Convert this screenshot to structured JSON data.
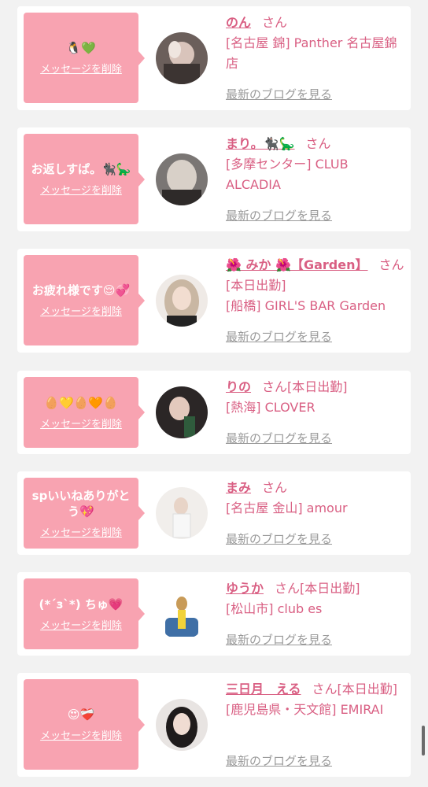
{
  "delete_label": "メッセージを削除",
  "blog_label": "最新のブログを見る",
  "san_label": "さん",
  "colors": {
    "accent": "#d95f83",
    "bubble": "#f8a3b1",
    "link_gray": "#9a9a9a",
    "background": "#f2f2f2"
  },
  "items": [
    {
      "message": "🐧💚",
      "name": "のん",
      "san": "さん",
      "shop": "[名古屋 錦] Panther 名古屋錦店"
    },
    {
      "message": "お返しすぱ。🐈‍⬛🦕",
      "name": "まり。🐈‍⬛🦕",
      "san": "さん",
      "shop": "[多摩センター] CLUB ALCADIA"
    },
    {
      "message": "お疲れ様です😌💞",
      "name": "🌺 みか 🌺【Garden】",
      "san": "さん[本日出勤]",
      "shop": "[船橋] GIRL'S BAR Garden"
    },
    {
      "message": "🥚💛🥚🧡🥚",
      "name": "りの",
      "san": "さん[本日出勤]",
      "shop": "[熱海] CLOVER"
    },
    {
      "message": "spいいねありがとう💖",
      "name": "まみ",
      "san": "さん",
      "shop": "[名古屋 金山] amour"
    },
    {
      "message": "(*´з`*) ちゅ💗",
      "name": "ゆうか",
      "san": "さん[本日出勤]",
      "shop": "[松山市] club es"
    },
    {
      "message": "😍❤️‍🩹",
      "name": "三日月　える",
      "san": "さん[本日出勤]",
      "shop": "[鹿児島県・天文館] EMIRAI"
    }
  ]
}
